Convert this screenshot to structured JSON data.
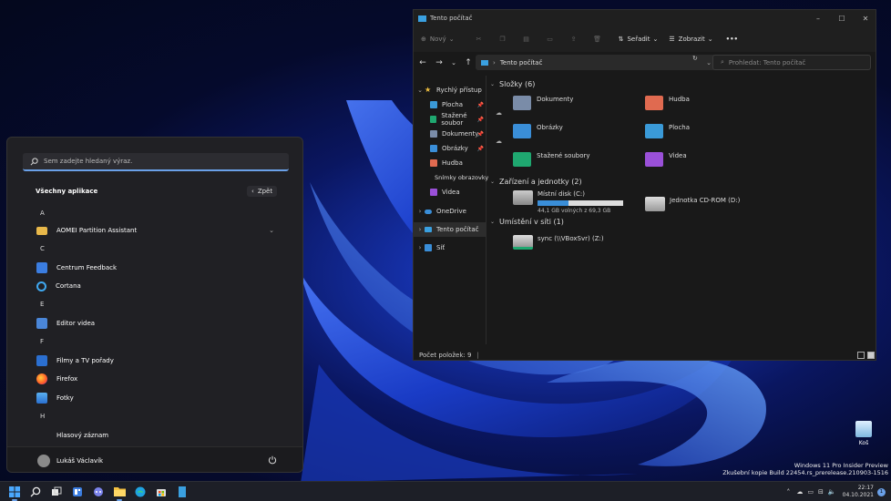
{
  "start_menu": {
    "search_placeholder": "Sem zadejte hledaný výraz.",
    "all_apps_label": "Všechny aplikace",
    "back_label": "Zpět",
    "back_icon": "chevron-left-icon",
    "groups": [
      {
        "letter": "A",
        "apps": [
          {
            "name": "AOMEI Partition Assistant",
            "icon": "folder-icon",
            "expandable": true
          }
        ]
      },
      {
        "letter": "C",
        "apps": [
          {
            "name": "Centrum Feedback",
            "icon": "feedback-icon"
          },
          {
            "name": "Cortana",
            "icon": "cortana-icon"
          }
        ]
      },
      {
        "letter": "E",
        "apps": [
          {
            "name": "Editor videa",
            "icon": "video-editor-icon"
          }
        ]
      },
      {
        "letter": "F",
        "apps": [
          {
            "name": "Filmy a TV pořady",
            "icon": "movies-icon"
          },
          {
            "name": "Firefox",
            "icon": "firefox-icon"
          },
          {
            "name": "Fotky",
            "icon": "photos-icon"
          }
        ]
      },
      {
        "letter": "H",
        "apps": [
          {
            "name": "Hlasový záznam",
            "icon": "voice-recorder-icon"
          }
        ]
      }
    ],
    "user_name": "Lukáš Václavík",
    "power_icon": "power-icon"
  },
  "explorer": {
    "window_title": "Tento počítač",
    "toolbar": {
      "new_label": "Nový",
      "sort_label": "Seřadit",
      "view_label": "Zobrazit",
      "more_label": "•••"
    },
    "address_path": "Tento počítač",
    "search_placeholder": "Prohledat: Tento počítač",
    "sidebar": [
      {
        "label": "Rychlý přístup",
        "icon": "star-icon",
        "expanded": true,
        "level": 0
      },
      {
        "label": "Plocha",
        "icon": "desktop-icon",
        "pinned": true,
        "level": 1
      },
      {
        "label": "Stažené soubor",
        "icon": "download-icon",
        "pinned": true,
        "level": 1
      },
      {
        "label": "Dokumenty",
        "icon": "documents-icon",
        "pinned": true,
        "level": 1
      },
      {
        "label": "Obrázky",
        "icon": "pictures-icon",
        "pinned": true,
        "level": 1
      },
      {
        "label": "Hudba",
        "icon": "music-icon",
        "level": 1
      },
      {
        "label": "Snímky obrazovky",
        "icon": "folder-icon",
        "level": 1
      },
      {
        "label": "Videa",
        "icon": "videos-icon",
        "level": 1
      },
      {
        "label": "OneDrive",
        "icon": "cloud-icon",
        "level": 0
      },
      {
        "label": "Tento počítač",
        "icon": "computer-icon",
        "level": 0,
        "selected": true
      },
      {
        "label": "Síť",
        "icon": "network-icon",
        "level": 0
      }
    ],
    "folders_section": "Složky (6)",
    "folders": [
      {
        "name": "Dokumenty",
        "icon": "documents-folder-icon",
        "cloud": true,
        "color": "#7a8ca8"
      },
      {
        "name": "Hudba",
        "icon": "music-folder-icon",
        "color": "#e06a50"
      },
      {
        "name": "Obrázky",
        "icon": "pictures-folder-icon",
        "cloud": true,
        "color": "#3a8ed8"
      },
      {
        "name": "Plocha",
        "icon": "desktop-folder-icon",
        "color": "#3a9ad8"
      },
      {
        "name": "Stažené soubory",
        "icon": "downloads-folder-icon",
        "color": "#1fa870"
      },
      {
        "name": "Videa",
        "icon": "videos-folder-icon",
        "color": "#9a50d8"
      }
    ],
    "drives_section": "Zařízení a jednotky (2)",
    "drives": [
      {
        "name": "Místní disk (C:)",
        "free": "44,1 GB volných z 69,3 GB",
        "used_fraction": 0.364,
        "icon": "windows-drive-icon"
      },
      {
        "name": "Jednotka CD-ROM (D:)",
        "icon": "cdrom-drive-icon"
      }
    ],
    "network_section": "Umístění v síti (1)",
    "network": [
      {
        "name": "sync (\\\\VBoxSvr) (Z:)",
        "icon": "network-drive-icon"
      }
    ],
    "status": "Počet položek: 9"
  },
  "desktop": {
    "recycle_bin": "Koš",
    "watermark_line1": "Windows 11 Pro Insider Preview",
    "watermark_line2": "Zkušební kopie Build 22454.rs_prerelease.210903-1516"
  },
  "taskbar": {
    "time": "22:17",
    "date": "04.10.2021",
    "notification_count": "1"
  }
}
